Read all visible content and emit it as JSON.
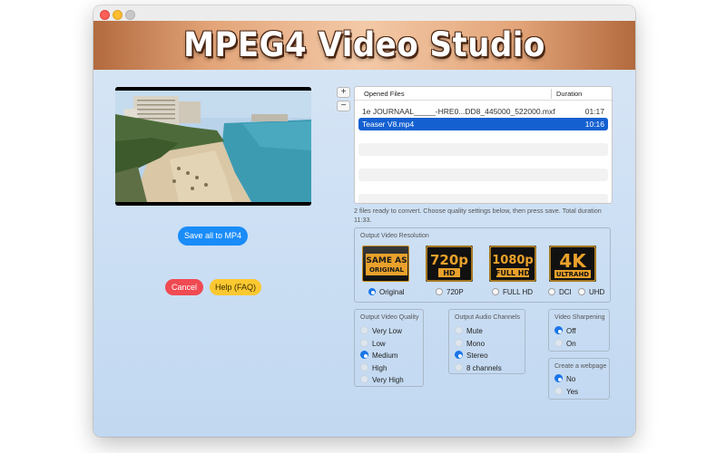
{
  "window": {
    "traffic_lights": [
      "close",
      "minimize",
      "zoom"
    ]
  },
  "banner": {
    "title": "MPEG4 Video Studio"
  },
  "actions": {
    "save_label": "Save all to MP4",
    "cancel_label": "Cancel",
    "help_label": "Help (FAQ)"
  },
  "file_controls": {
    "add_label": "+",
    "remove_label": "−"
  },
  "files": {
    "col_files": "Opened Files",
    "col_duration": "Duration",
    "rows": [
      {
        "name": "1e JOURNAAL_____-HRE0...DD8_445000_522000.mxf",
        "duration": "01:17",
        "selected": false
      },
      {
        "name": "Teaser V8.mp4",
        "duration": "10:16",
        "selected": true
      }
    ]
  },
  "status": {
    "text": "2 files ready to convert. Choose quality settings below, then press save. Total duration 11:33."
  },
  "resolution": {
    "title": "Output Video Resolution",
    "badges": [
      {
        "line1": "SAME AS",
        "line2": "ORIGINAL"
      },
      {
        "line1": "720p",
        "line2": "HD"
      },
      {
        "line1": "1080p",
        "line2": "FULL HD"
      },
      {
        "line1": "4K",
        "line2": "ULTRAHD"
      }
    ],
    "options": [
      "Original",
      "720P",
      "FULL HD",
      "DCI",
      "UHD"
    ],
    "selected": "Original"
  },
  "quality": {
    "title": "Output Video Quality",
    "options": [
      "Very Low",
      "Low",
      "Medium",
      "High",
      "Very High"
    ],
    "selected": "Medium"
  },
  "audio": {
    "title": "Output Audio Channels",
    "options": [
      "Mute",
      "Mono",
      "Stereo",
      "8 channels"
    ],
    "selected": "Stereo"
  },
  "sharpening": {
    "title": "Video Sharpening",
    "options": [
      "Off",
      "On"
    ],
    "selected": "Off"
  },
  "webpage": {
    "title": "Create a webpage",
    "options": [
      "No",
      "Yes"
    ],
    "selected": "No"
  },
  "colors": {
    "accent": "#1a74e8",
    "save": "#1a8cf8",
    "cancel": "#f04a52",
    "help": "#fbc830",
    "selected_row": "#1460d1"
  }
}
